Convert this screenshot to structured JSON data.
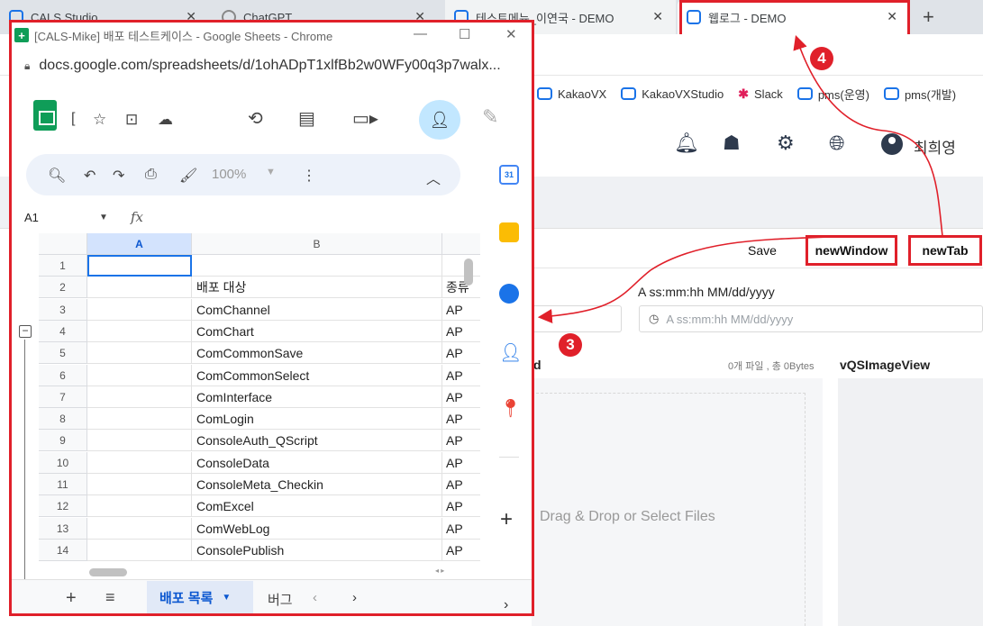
{
  "browser": {
    "tabs": [
      {
        "title": "CALS Studio",
        "close": "✕"
      },
      {
        "title": "ChatGPT",
        "close": "✕"
      },
      {
        "title": "테스트메뉴_이연국 - DEMO",
        "close": "✕"
      },
      {
        "title": "웹로그 - DEMO",
        "close": "✕"
      }
    ],
    "new_tab_glyph": "+",
    "bookmarks": [
      {
        "label": "KakaoVX"
      },
      {
        "label": "KakaoVXStudio"
      },
      {
        "label": "Slack"
      },
      {
        "label": "pms(운영)"
      },
      {
        "label": "pms(개발)"
      }
    ]
  },
  "app": {
    "header_icons": [
      "bell-icon",
      "sitemap-icon",
      "gear-icon",
      "globe-icon"
    ],
    "user_name": "최희영",
    "buttons": {
      "save": "Save",
      "new_window": "newWindow",
      "new_tab": "newTab"
    },
    "datetime": {
      "label": "A ss:mm:hh MM/dd/yyyy",
      "placeholder": "A ss:mm:hh MM/dd/yyyy"
    },
    "upload": {
      "title": "d",
      "count": "0개 파일 , 총 0Bytes",
      "drop_text": "Drag & Drop or Select Files"
    },
    "image_view_title": "vQSImageView"
  },
  "annotations": {
    "step3": "3",
    "step4": "4"
  },
  "popup": {
    "window_title": "[CALS-Mike] 배포 테스트케이스 - Google Sheets - Chrome",
    "url": "docs.google.com/spreadsheets/d/1ohADpT1xlfBb2w0WFy00q3p7walx...",
    "doc_title_partial": "[",
    "zoom": "100%",
    "name_box": "A1",
    "fx": "fx",
    "columns": [
      "A",
      "B"
    ],
    "rows": [
      {
        "num": "1",
        "b": "",
        "c": ""
      },
      {
        "num": "2",
        "b": "배포 대상",
        "c": "종류"
      },
      {
        "num": "3",
        "b": "ComChannel",
        "c": "AP"
      },
      {
        "num": "4",
        "b": "ComChart",
        "c": "AP"
      },
      {
        "num": "5",
        "b": "ComCommonSave",
        "c": "AP"
      },
      {
        "num": "6",
        "b": "ComCommonSelect",
        "c": "AP"
      },
      {
        "num": "7",
        "b": "ComInterface",
        "c": "AP"
      },
      {
        "num": "8",
        "b": "ComLogin",
        "c": "AP"
      },
      {
        "num": "9",
        "b": "ConsoleAuth_QScript",
        "c": "AP"
      },
      {
        "num": "10",
        "b": "ConsoleData",
        "c": "AP"
      },
      {
        "num": "11",
        "b": "ConsoleMeta_Checkin",
        "c": "AP"
      },
      {
        "num": "12",
        "b": "ComExcel",
        "c": "AP"
      },
      {
        "num": "13",
        "b": "ComWebLog",
        "c": "AP"
      },
      {
        "num": "14",
        "b": "ConsolePublish",
        "c": "AP"
      }
    ],
    "sheet_tabs": {
      "active": "배포 목록",
      "next": "버그"
    },
    "side_calendar_day": "31"
  }
}
